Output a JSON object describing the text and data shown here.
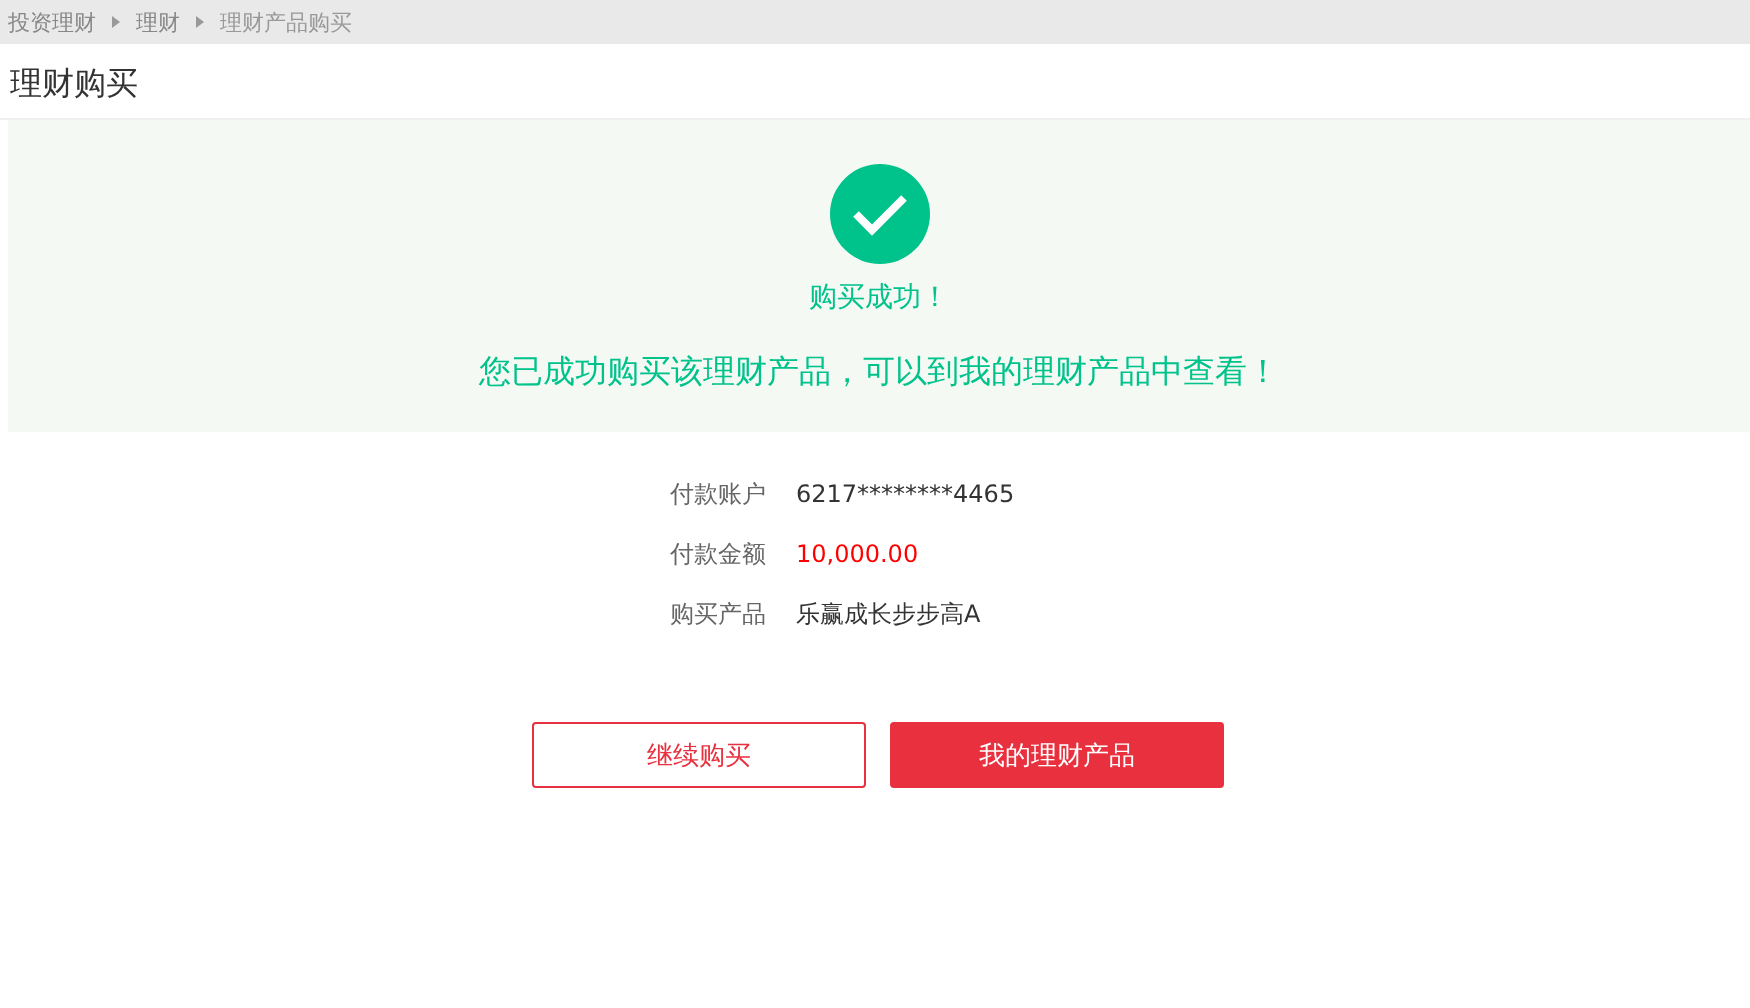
{
  "breadcrumb": [
    {
      "label": "投资理财",
      "current": false
    },
    {
      "label": "理财",
      "current": false
    },
    {
      "label": "理财产品购买",
      "current": true
    }
  ],
  "page_title": "理财购买",
  "result": {
    "success": true,
    "headline": "购买成功！",
    "message": "您已成功购买该理财产品，可以到我的理财产品中查看！"
  },
  "details": [
    {
      "label": "付款账户",
      "value": "6217********4465",
      "kind": "plain"
    },
    {
      "label": "付款金额",
      "value": "10,000.00",
      "kind": "amount"
    },
    {
      "label": "购买产品",
      "value": "乐赢成长步步高A",
      "kind": "plain"
    }
  ],
  "buttons": [
    {
      "label": "继续购买",
      "kind": "outline"
    },
    {
      "label": "我的理财产品",
      "kind": "primary"
    }
  ]
}
